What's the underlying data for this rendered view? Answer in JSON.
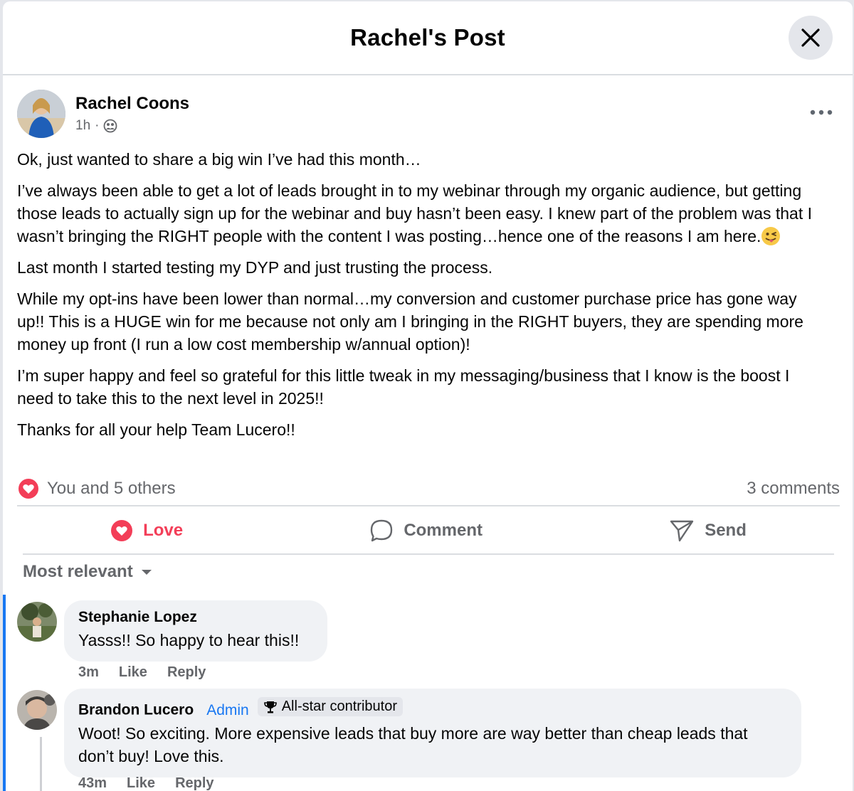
{
  "modal": {
    "title": "Rachel's Post"
  },
  "post": {
    "author": "Rachel Coons",
    "time": "1h",
    "separator": "·",
    "audience_icon": "group-icon",
    "paragraphs": [
      "Ok, just wanted to share a big win I’ve had this month…",
      "I’ve always been able to get a lot of leads brought in to my webinar through my organic audience, but getting those leads to actually sign up for the webinar and buy hasn’t been easy. I knew part of the problem was that I wasn’t bringing the RIGHT people with the content I was posting…hence one of the reasons I am here.",
      "Last month I started testing my DYP and just trusting the process.",
      "While my opt-ins have been lower than normal…my conversion and customer purchase price has gone way up!! This is a HUGE win for me because not only am I bringing in the RIGHT buyers, they are spending more money up front (I run a low cost membership w/annual option)!",
      "I’m super happy and feel so grateful for this little tweak in my messaging/business that I know is the boost I need to take this to the next level in 2025!!",
      "Thanks for all your help Team Lucero!!"
    ],
    "emoji_icon": "winking-tongue-emoji-icon",
    "reactions_text": "You and 5 others",
    "comments_count": "3 comments"
  },
  "actions": {
    "love": "Love",
    "comment": "Comment",
    "send": "Send"
  },
  "sort": {
    "label": "Most relevant"
  },
  "comments": [
    {
      "name": "Stephanie Lopez",
      "text": "Yasss!! So happy to hear this!!",
      "time": "3m",
      "like": "Like",
      "reply": "Reply"
    },
    {
      "name": "Brandon Lucero",
      "role": "Admin",
      "badge": "All-star contributor",
      "text": "Woot! So exciting. More expensive leads that buy more are way better than cheap leads that don’t buy! Love this.",
      "time": "43m",
      "like": "Like",
      "reply": "Reply"
    }
  ],
  "colors": {
    "love": "#f33e58",
    "admin": "#1877f2",
    "bubble": "#f0f2f5"
  }
}
